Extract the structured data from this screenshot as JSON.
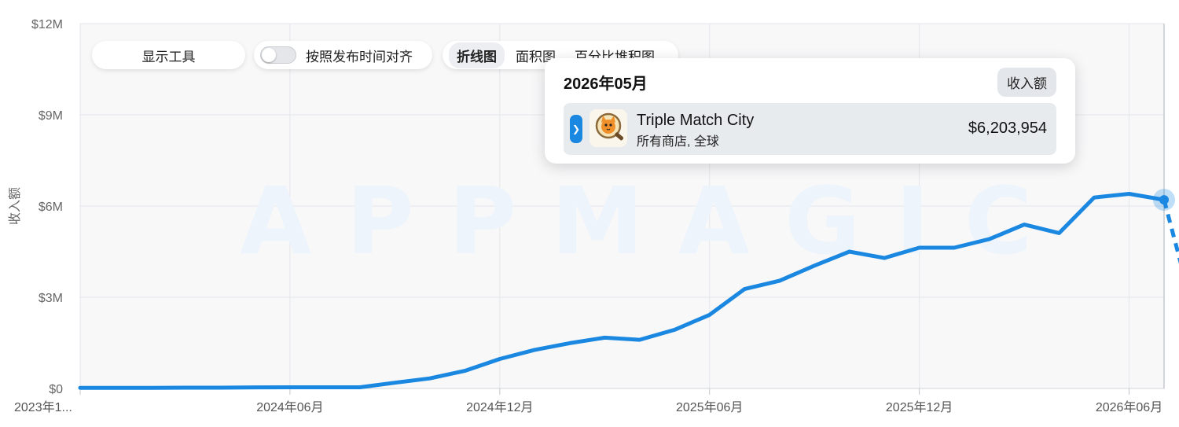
{
  "toolbar": {
    "display_tools_label": "显示工具",
    "align_toggle_label": "按照发布时间对齐",
    "chart_types": [
      "折线图",
      "面积图",
      "百分比堆积图"
    ],
    "active_chart_type": "折线图"
  },
  "tooltip": {
    "date": "2026年05月",
    "metric_badge": "收入额",
    "app_name": "Triple Match City",
    "app_subtitle": "所有商店, 全球",
    "value": "$6,203,954",
    "app_icon": "cat-detective-app-icon"
  },
  "watermark": "APPMAGIC",
  "colors": {
    "line": "#1a87e1",
    "grid": "#e3e6ea",
    "plot_background": "#f8f8f9"
  },
  "chart_data": {
    "type": "line",
    "title": "",
    "xlabel": "",
    "ylabel": "收入额",
    "ylim": [
      0,
      12000000
    ],
    "y_ticks": [
      0,
      3000000,
      6000000,
      9000000,
      12000000
    ],
    "y_tick_labels": [
      "$0",
      "$3M",
      "$6M",
      "$9M",
      "$12M"
    ],
    "x_tick_labels": [
      "2023年1...",
      "2024年06月",
      "2024年12月",
      "2025年06月",
      "2025年12月",
      "2026年06月"
    ],
    "x_tick_dates": [
      "2023-12",
      "2024-06",
      "2024-12",
      "2025-06",
      "2025-12",
      "2026-06"
    ],
    "x_range": [
      "2023-12",
      "2026-07"
    ],
    "grid": true,
    "legend": "none",
    "series": [
      {
        "name": "Triple Match City",
        "color": "#1a87e1",
        "points": [
          {
            "x": "2023-12",
            "y": 20000
          },
          {
            "x": "2024-01",
            "y": 20000
          },
          {
            "x": "2024-02",
            "y": 20000
          },
          {
            "x": "2024-03",
            "y": 25000
          },
          {
            "x": "2024-04",
            "y": 25000
          },
          {
            "x": "2024-05",
            "y": 35000
          },
          {
            "x": "2024-06",
            "y": 40000
          },
          {
            "x": "2024-07",
            "y": 40000
          },
          {
            "x": "2024-08",
            "y": 40000
          },
          {
            "x": "2024-09",
            "y": 190000
          },
          {
            "x": "2024-10",
            "y": 330000
          },
          {
            "x": "2024-11",
            "y": 580000
          },
          {
            "x": "2024-12",
            "y": 970000
          },
          {
            "x": "2025-01",
            "y": 1270000
          },
          {
            "x": "2025-02",
            "y": 1490000
          },
          {
            "x": "2025-03",
            "y": 1670000
          },
          {
            "x": "2025-04",
            "y": 1600000
          },
          {
            "x": "2025-05",
            "y": 1930000
          },
          {
            "x": "2025-06",
            "y": 2420000
          },
          {
            "x": "2025-07",
            "y": 3270000
          },
          {
            "x": "2025-08",
            "y": 3540000
          },
          {
            "x": "2025-09",
            "y": 4040000
          },
          {
            "x": "2025-10",
            "y": 4500000
          },
          {
            "x": "2025-11",
            "y": 4290000
          },
          {
            "x": "2025-12",
            "y": 4630000
          },
          {
            "x": "2026-01",
            "y": 4630000
          },
          {
            "x": "2026-02",
            "y": 4910000
          },
          {
            "x": "2026-03",
            "y": 5390000
          },
          {
            "x": "2026-04",
            "y": 5110000
          },
          {
            "x": "2026-05",
            "y": 6280000
          },
          {
            "x": "2026-06",
            "y": 6400000
          },
          {
            "x": "2026-07",
            "y": 6203954
          }
        ]
      }
    ],
    "projection": {
      "style": "dashed",
      "points": [
        {
          "x": "2026-07",
          "y": 6203954
        },
        {
          "x": "2026-08",
          "y": 1850000
        }
      ]
    },
    "highlighted_point": {
      "x": "2026-07",
      "y": 6203954
    }
  }
}
